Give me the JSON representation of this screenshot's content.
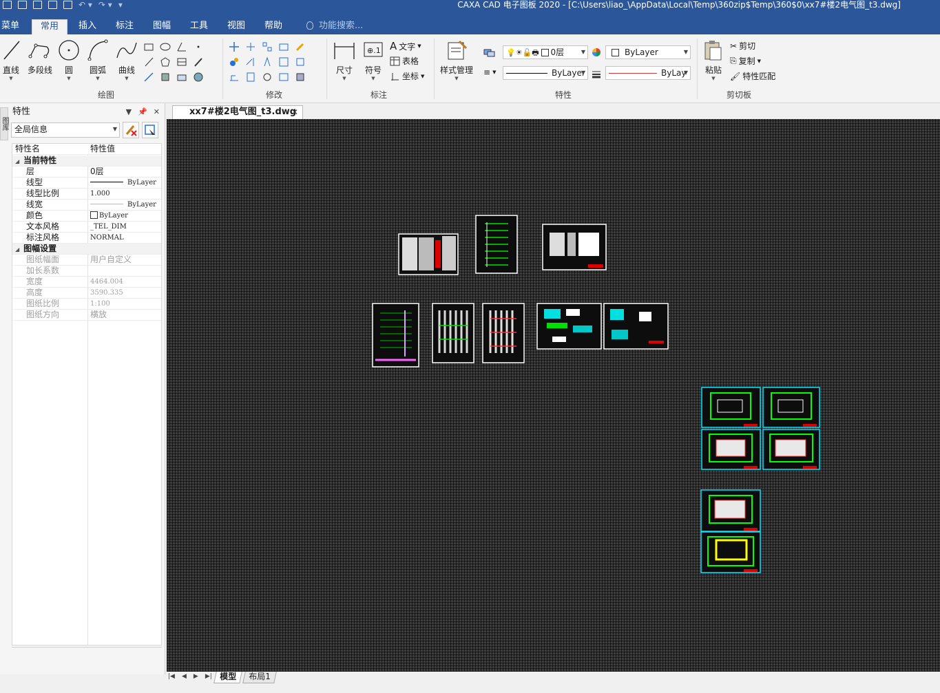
{
  "titlebar": {
    "title": "CAXA CAD 电子图板 2020 - [C:\\Users\\liao_\\AppData\\Local\\Temp\\360zip$Temp\\360$0\\xx7#楼2电气图_t3.dwg]"
  },
  "menu": {
    "tabs": [
      "菜单",
      "常用",
      "插入",
      "标注",
      "图幅",
      "工具",
      "视图",
      "帮助"
    ],
    "active": "常用",
    "search_placeholder": "功能搜索..."
  },
  "ribbon": {
    "draw": {
      "group_label": "绘图",
      "buttons": [
        "直线",
        "多段线",
        "圆",
        "圆弧",
        "曲线"
      ]
    },
    "modify": {
      "group_label": "修改"
    },
    "annotate": {
      "group_label": "标注",
      "buttons": [
        "尺寸",
        "符号"
      ],
      "small": [
        "文字",
        "表格",
        "坐标"
      ]
    },
    "properties": {
      "group_label": "特性",
      "style_button": "样式管理",
      "layer_value": "0层",
      "color_value": "ByLayer",
      "linetype_value": "ByLayer",
      "lineweight_value": "ByLay"
    },
    "clipboard": {
      "group_label": "剪切板",
      "paste": "粘贴",
      "cut": "剪切",
      "copy": "复制",
      "match": "特性匹配"
    }
  },
  "panel": {
    "side_tab": "图库",
    "title": "特性",
    "scope": "全局信息",
    "columns": [
      "特性名",
      "特性值"
    ],
    "categories": [
      {
        "name": "当前特性",
        "rows": [
          {
            "name": "层",
            "value": "0层"
          },
          {
            "name": "线型",
            "value": "ByLayer"
          },
          {
            "name": "线型比例",
            "value": "1.000"
          },
          {
            "name": "线宽",
            "value": "ByLayer"
          },
          {
            "name": "颜色",
            "value": "ByLayer"
          },
          {
            "name": "文本风格",
            "value": "_TEL_DIM"
          },
          {
            "name": "标注风格",
            "value": "NORMAL"
          }
        ]
      },
      {
        "name": "图幅设置",
        "rows": [
          {
            "name": "图纸幅面",
            "value": "用户自定义"
          },
          {
            "name": "加长系数",
            "value": ""
          },
          {
            "name": "宽度",
            "value": "4464.004"
          },
          {
            "name": "高度",
            "value": "3590.335"
          },
          {
            "name": "图纸比例",
            "value": "1:100"
          },
          {
            "name": "图纸方向",
            "value": "横放"
          }
        ]
      }
    ]
  },
  "document": {
    "tab_label": "xx7#楼2电气图_t3.dwg"
  },
  "layout_tabs": [
    "模型",
    "布局1"
  ],
  "colors": {
    "accent": "#2b579a",
    "canvas_bg": "#3c3c3c",
    "sheet_border": "#ffffff",
    "cyan_sheet": "#00e5ff",
    "green": "#00ff00",
    "red": "#ff0000",
    "yellow": "#ffff00"
  }
}
